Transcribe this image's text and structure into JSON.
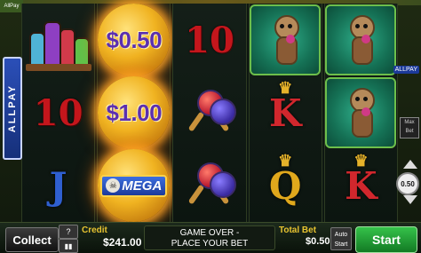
{
  "game": {
    "side_label_left": "ALLPAY",
    "side_label_right": "ALLPAY",
    "corner_label": "AllPay",
    "max_bet_label": "Max Bet",
    "bet_dial_value": "0.50"
  },
  "reels": [
    [
      "potions",
      "10",
      "J"
    ],
    [
      "$0.50",
      "$1.00",
      "MEGA"
    ],
    [
      "10",
      "maracas",
      "maracas"
    ],
    [
      "doll",
      "K",
      "Q"
    ],
    [
      "doll",
      "doll",
      "K"
    ]
  ],
  "coins": {
    "top": "$0.50",
    "middle": "$1.00",
    "mega": "MEGA"
  },
  "symbols": {
    "ten": "10",
    "jack": "J",
    "king": "K",
    "queen": "Q"
  },
  "bottom_bar": {
    "collect_label": "Collect",
    "help_label": "?",
    "sound_label": "▮▮",
    "credit_label": "Credit",
    "credit_value": "$241.00",
    "message_line1": "GAME OVER -",
    "message_line2": "PLACE YOUR BET",
    "total_bet_label": "Total Bet",
    "total_bet_value": "$0.50",
    "auto_label_1": "Auto",
    "auto_label_2": "Start",
    "start_label": "Start"
  },
  "colors": {
    "ten": "#c4161c",
    "king": "#d1272d",
    "queen": "#e0a81c",
    "jack": "#2f5fd0",
    "coin_text": "#5b2fb0",
    "start_button": "#35c24a",
    "label_gold": "#e7c330"
  }
}
